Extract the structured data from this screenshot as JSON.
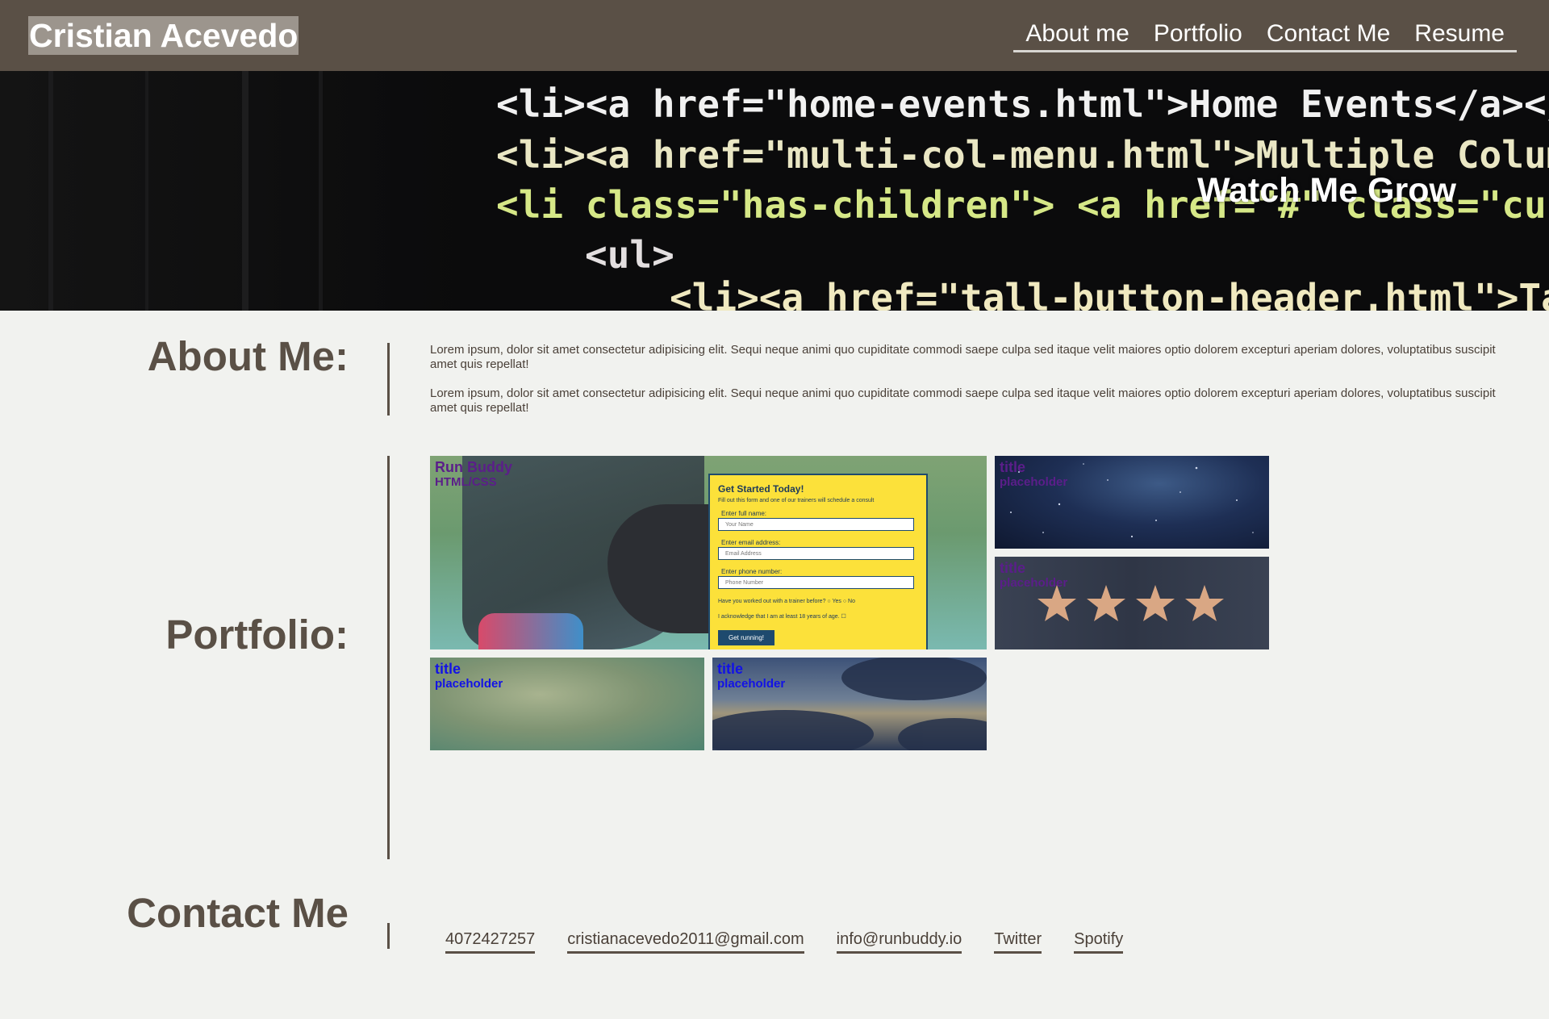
{
  "header": {
    "brand": "Cristian Acevedo",
    "nav": [
      "About me",
      "Portfolio",
      "Contact Me",
      "Resume"
    ]
  },
  "hero": {
    "title": "Watch Me Grow",
    "code_lines": [
      "<li><a href=\"home-events.html\">Home Events</a></li>",
      "<li><a href=\"multi-col-menu.html\">Multiple Column Menu",
      "<li class=\"has-children\"> <a href=\"#\" class=\"current\">",
      "<ul>",
      "<li><a href=\"tall-button-header.html\">Tall But"
    ]
  },
  "about": {
    "heading": "About Me:",
    "paragraphs": [
      "Lorem ipsum, dolor sit amet consectetur adipisicing elit. Sequi neque animi quo cupiditate commodi saepe culpa sed itaque velit maiores optio dolorem excepturi aperiam dolores, voluptatibus suscipit amet quis repellat!",
      "Lorem ipsum, dolor sit amet consectetur adipisicing elit. Sequi neque animi quo cupiditate commodi saepe culpa sed itaque velit maiores optio dolorem excepturi aperiam dolores, voluptatibus suscipit amet quis repellat!"
    ]
  },
  "portfolio": {
    "heading": "Portfolio:",
    "featured": {
      "title": "Run Buddy",
      "subtitle": "HTML/CSS",
      "form": {
        "heading": "Get Started Today!",
        "note": "Fill out this form and one of our trainers will schedule a consult",
        "name_label": "Enter full name:",
        "name_placeholder": "Your Name",
        "email_label": "Enter email address:",
        "email_placeholder": "Email Address",
        "phone_label": "Enter phone number:",
        "phone_placeholder": "Phone Number",
        "question": "Have you worked out with a trainer before?",
        "yes": "Yes",
        "no": "No",
        "ack": "I acknowledge that I am at least 18 years of age.",
        "button": "Get running!"
      }
    },
    "tiles": [
      {
        "title": "title",
        "subtitle": "placeholder",
        "theme": "galaxy"
      },
      {
        "title": "title",
        "subtitle": "placeholder",
        "theme": "stars"
      },
      {
        "title": "title",
        "subtitle": "placeholder",
        "theme": "texture"
      },
      {
        "title": "title",
        "subtitle": "placeholder",
        "theme": "clouds"
      }
    ]
  },
  "contact": {
    "heading": "Contact Me",
    "links": [
      "4072427257",
      "cristianacevedo2011@gmail.com",
      "info@runbuddy.io",
      "Twitter",
      "Spotify"
    ]
  },
  "colors": {
    "header_bg": "#5a5046",
    "page_bg": "#f1f2ef",
    "heading_text": "#5a5046",
    "tile_text_purple": "#5b1e8a",
    "tile_text_blue": "#1212e6"
  }
}
